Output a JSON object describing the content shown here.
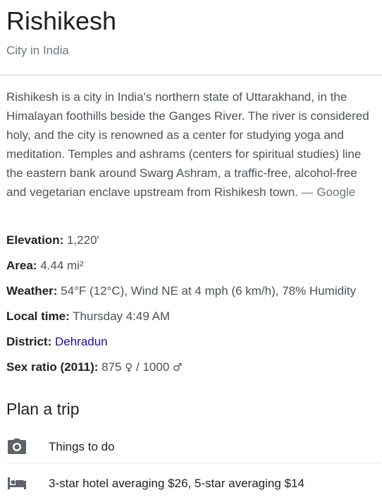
{
  "header": {
    "title": "Rishikesh",
    "subtitle": "City in India"
  },
  "description": {
    "text": "Rishikesh is a city in India's northern state of Uttarakhand, in the Himalayan foothills beside the Ganges River. The river is considered holy, and the city is renowned as a center for studying yoga and meditation. Temples and ashrams (centers for spiritual studies) line the eastern bank around Swarg Ashram, a traffic-free, alcohol-free and vegetarian enclave upstream from Rishikesh town.",
    "source": "— Google"
  },
  "facts": {
    "elevation": {
      "label": "Elevation:",
      "value": "1,220'"
    },
    "area": {
      "label": "Area:",
      "value": "4.44 mi²"
    },
    "weather": {
      "label": "Weather:",
      "value": "54°F (12°C), Wind NE at 4 mph (6 km/h), 78% Humidity"
    },
    "local_time": {
      "label": "Local time:",
      "value": "Thursday 4:49 AM"
    },
    "district": {
      "label": "District:",
      "value": "Dehradun"
    },
    "sex_ratio": {
      "label": "Sex ratio (2011):",
      "female_value": "875",
      "female_symbol": "♀",
      "separator": "/",
      "male_value": "1000",
      "male_symbol": "♂"
    }
  },
  "plan_trip": {
    "title": "Plan a trip",
    "items": [
      {
        "icon": "camera-icon",
        "label": "Things to do"
      },
      {
        "icon": "hotel-bed-icon",
        "label": "3-star hotel averaging $26, 5-star averaging $14"
      }
    ]
  },
  "colors": {
    "title": "#202124",
    "body_text": "#4d5156",
    "secondary_text": "#70757a",
    "link": "#1a0dab",
    "divider": "#dadce0",
    "icon": "#5f6368"
  }
}
